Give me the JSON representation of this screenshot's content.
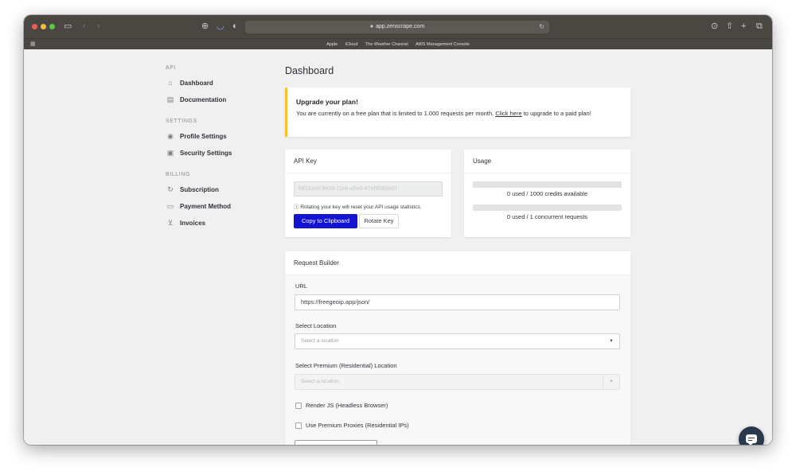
{
  "browser": {
    "url": "app.zenscrape.com",
    "favorites": [
      "Apple",
      "iCloud",
      "The Weather Channel",
      "AWS Management Console"
    ]
  },
  "sidebar": {
    "sections": [
      {
        "heading": "API",
        "items": [
          {
            "label": "Dashboard",
            "icon": "home-icon"
          },
          {
            "label": "Documentation",
            "icon": "document-icon"
          }
        ]
      },
      {
        "heading": "SETTINGS",
        "items": [
          {
            "label": "Profile Settings",
            "icon": "user-icon"
          },
          {
            "label": "Security Settings",
            "icon": "lock-icon"
          }
        ]
      },
      {
        "heading": "BILLING",
        "items": [
          {
            "label": "Subscription",
            "icon": "refresh-icon"
          },
          {
            "label": "Payment Method",
            "icon": "credit-card-icon"
          },
          {
            "label": "Invoices",
            "icon": "cart-icon"
          }
        ]
      }
    ]
  },
  "main": {
    "title": "Dashboard",
    "alert": {
      "title": "Upgrade your plan!",
      "text_before": "You are currently on a free plan that is limited to 1.000 requests per month. ",
      "link": "Click here",
      "text_after": " to upgrade to a paid plan!",
      "accent_color": "#f5c02a"
    },
    "api_key": {
      "header": "API Key",
      "value": "f8f183e0-8e2d-11eb-a5e8-47af8f9b3d2f",
      "note": "Rotating your key will reset your API usage statistics.",
      "copy_label": "Copy to Clipboard",
      "rotate_label": "Rotate Key",
      "copy_color": "#1414d4"
    },
    "usage": {
      "header": "Usage",
      "credits_text": "0 used / 1000 credits available",
      "credits_fraction": 0,
      "concurrent_text": "0 used / 1 concurrent requests",
      "concurrent_fraction": 0
    },
    "builder": {
      "header": "Request Builder",
      "url_label": "URL",
      "url_value": "https://freegeoip.app/json/",
      "location_label": "Select Location",
      "location_placeholder": "Select a location",
      "premium_label": "Select Premium (Residential) Location",
      "premium_placeholder": "Select a location",
      "render_js_label": "Render JS (Headless Browser)",
      "premium_proxies_label": "Use Premium Proxies (Residential IPs)"
    }
  }
}
